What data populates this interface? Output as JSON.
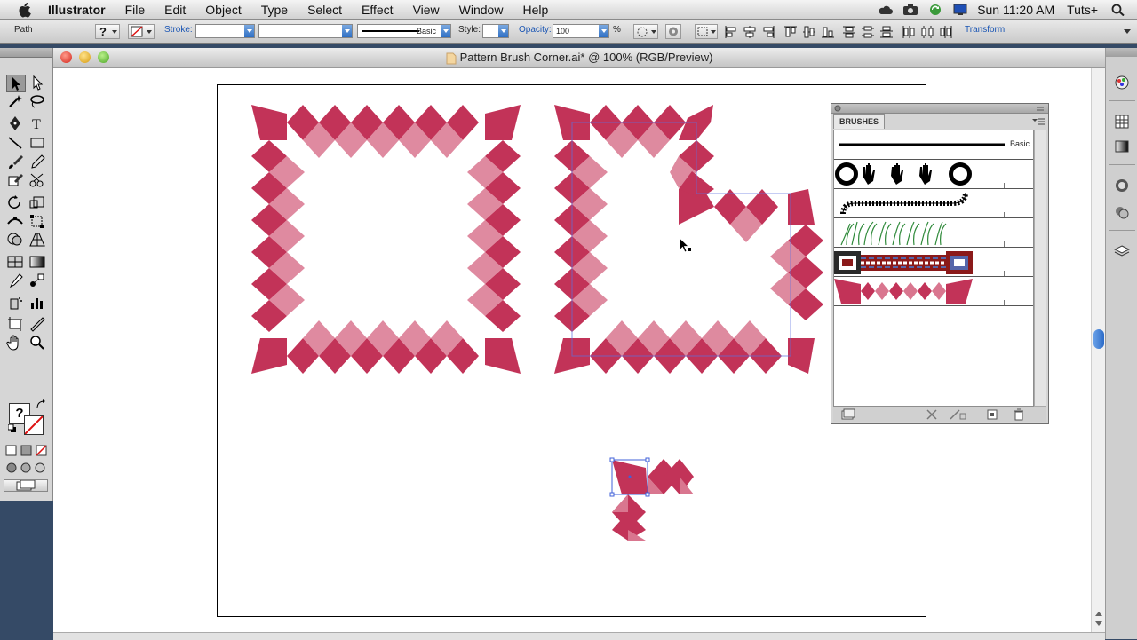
{
  "menubar": {
    "app_name": "Illustrator",
    "menus": [
      "File",
      "Edit",
      "Object",
      "Type",
      "Select",
      "Effect",
      "View",
      "Window",
      "Help"
    ],
    "clock": "Sun 11:20 AM",
    "user": "Tuts+"
  },
  "controlbar": {
    "selection_label": "Path",
    "stroke_label": "Stroke:",
    "brush_name": "Basic",
    "style_label": "Style:",
    "opacity_label": "Opacity:",
    "opacity_value": "100",
    "opacity_unit": "%",
    "transform_link": "Transform"
  },
  "window": {
    "title": "Pattern Brush Corner.ai* @ 100% (RGB/Preview)"
  },
  "brushes_panel": {
    "tab_label": "BRUSHES",
    "basic_label": "Basic"
  },
  "colors": {
    "pattern_dark": "#c23358",
    "pattern_light": "#d9768f",
    "selection_blue": "#4060d8"
  }
}
